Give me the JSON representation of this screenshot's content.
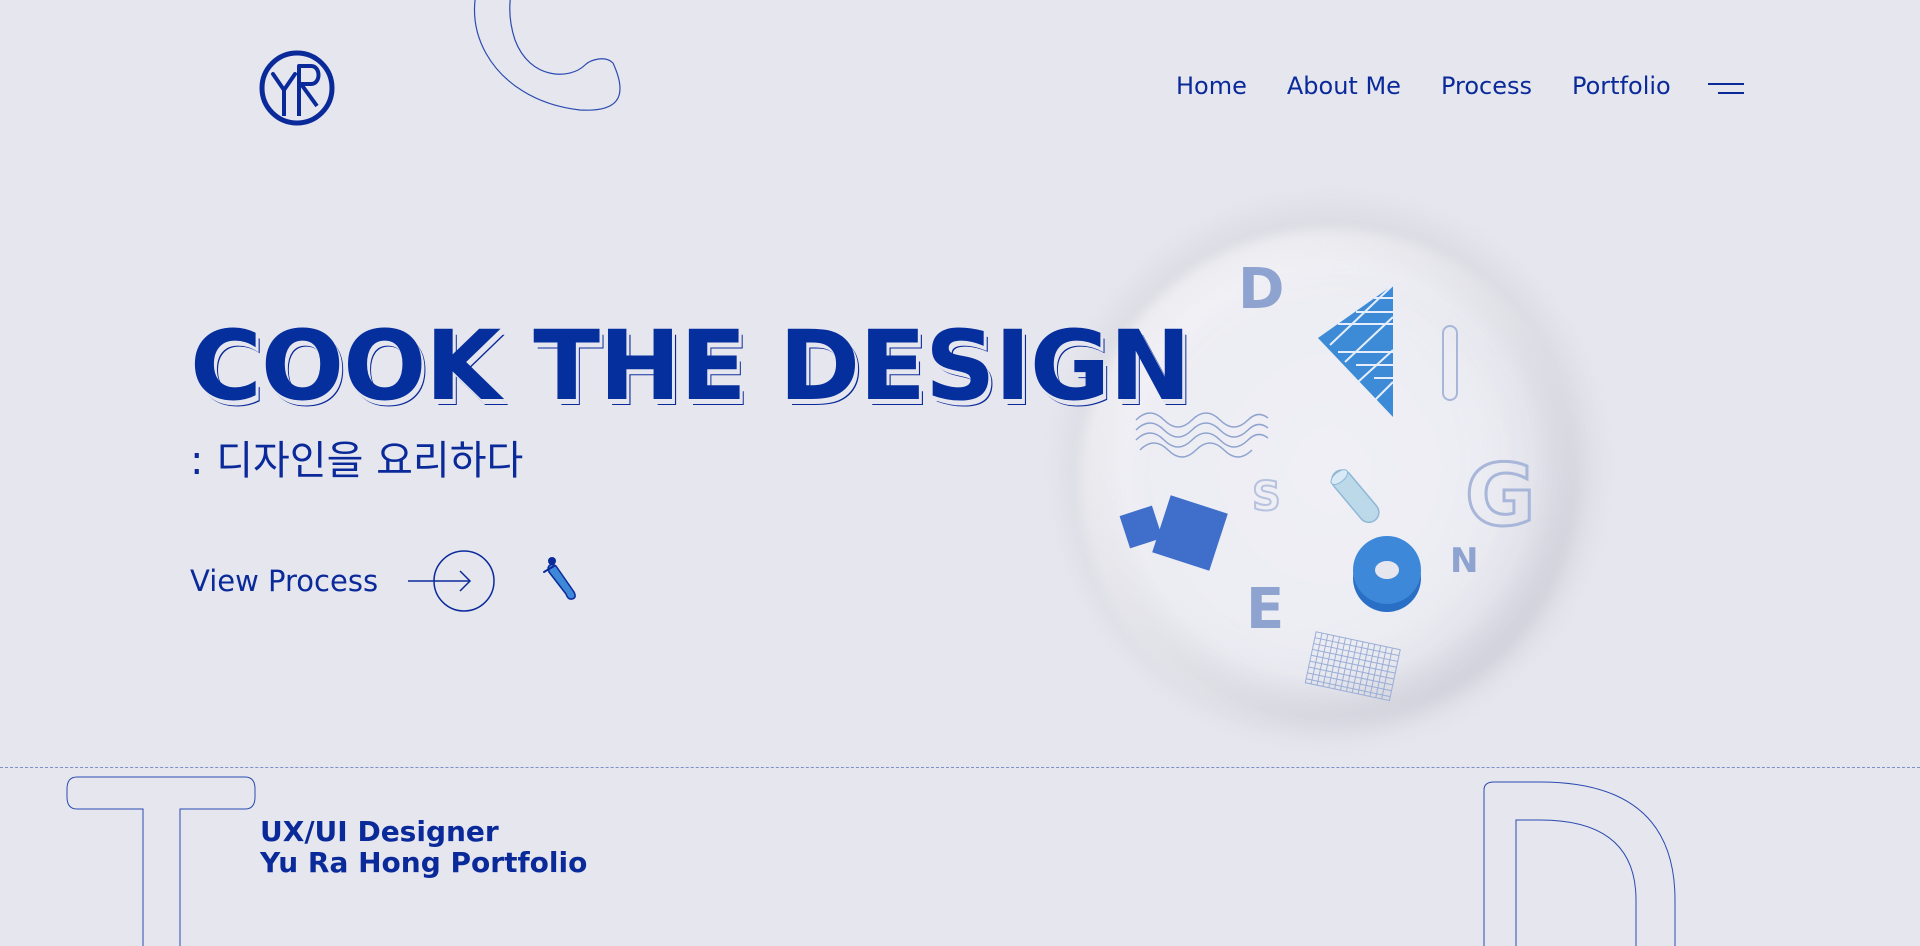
{
  "header": {
    "logo_alt": "YR",
    "nav": [
      {
        "label": "Home"
      },
      {
        "label": "About Me"
      },
      {
        "label": "Process"
      },
      {
        "label": "Portfolio"
      }
    ],
    "menu_icon": "hamburger-menu-icon"
  },
  "hero": {
    "title": "COOK THE DESIGN",
    "subtitle": ": 디자인을 요리하다",
    "cta_label": "View Process",
    "cta_icon": "arrow-right-circle-icon",
    "spoon_icon": "spoon-icon"
  },
  "plate": {
    "letters": [
      "D",
      "I",
      "S",
      "G",
      "N",
      "E"
    ]
  },
  "footer": {
    "line1": "UX/UI Designer",
    "line2": "Yu Ra Hong Portfolio"
  },
  "colors": {
    "background": "#e6e6ef",
    "primary": "#0a2a9a",
    "accent": "#3d6fcf",
    "muted_letter": "#8ea3cf"
  }
}
